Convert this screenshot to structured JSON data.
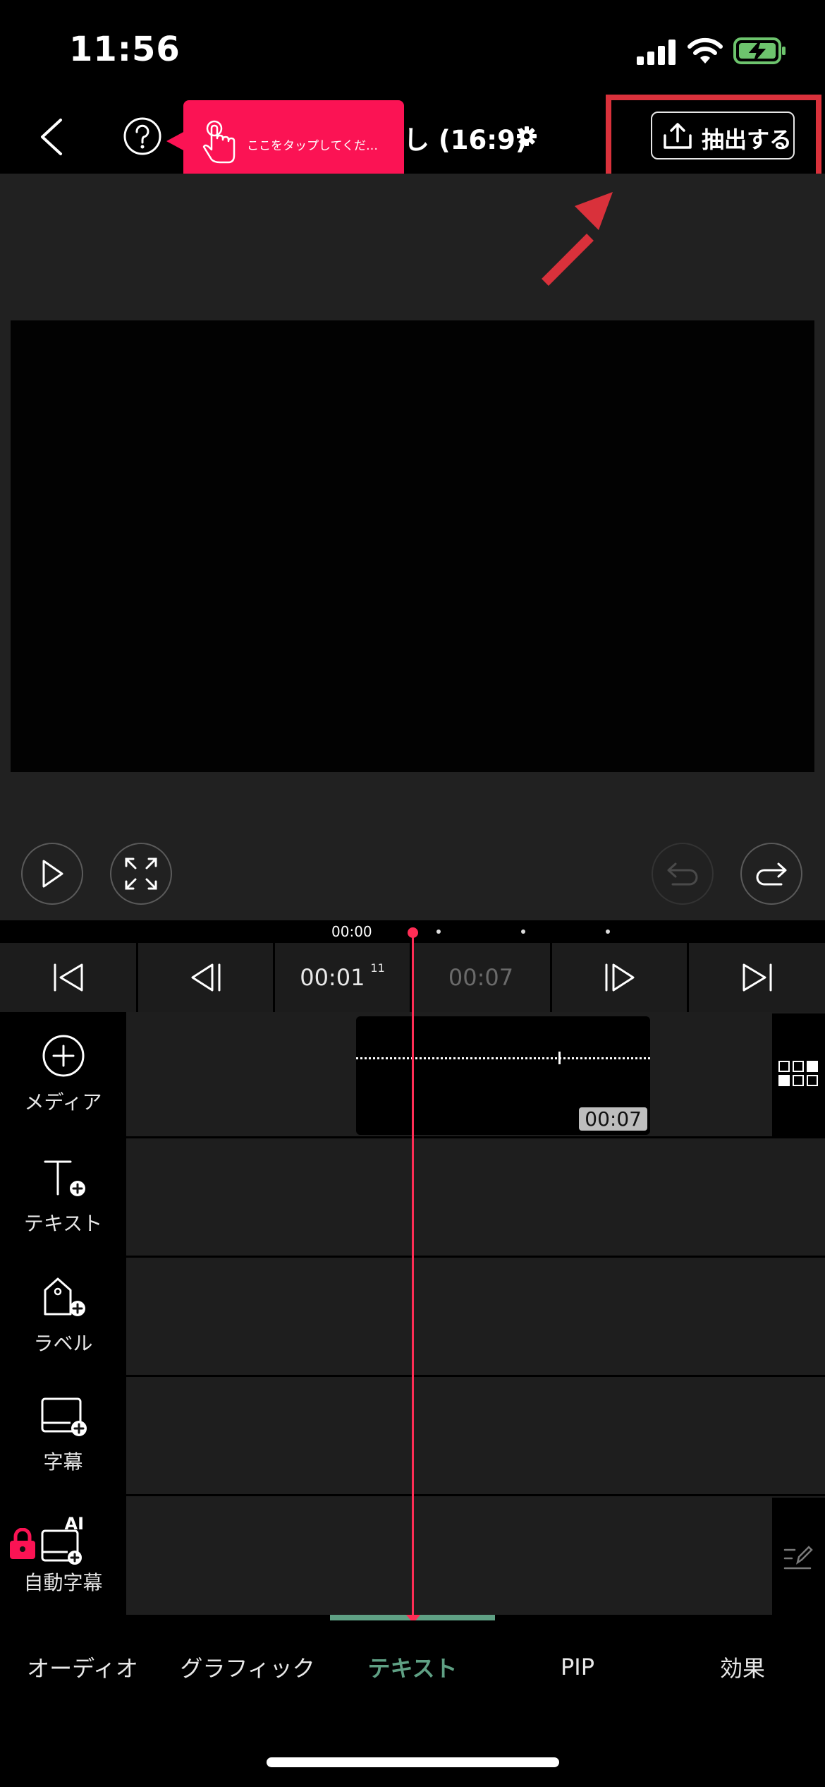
{
  "status_bar": {
    "time": "11:56"
  },
  "header": {
    "title": "し (16:9)",
    "tooltip_text": "ここをタップしてくだ…",
    "export_label": "抽出する"
  },
  "timeline": {
    "ruler_time": "00:00",
    "current_time": "00:01",
    "current_frame": "11",
    "duration": "00:07",
    "clip_duration": "00:07"
  },
  "tracks": {
    "media": "メディア",
    "text": "テキスト",
    "label": "ラベル",
    "subtitle": "字幕",
    "auto_subtitle": "自動字幕",
    "ai_badge": "AI"
  },
  "tabs": [
    {
      "label": "オーディオ"
    },
    {
      "label": "グラフィック"
    },
    {
      "label": "テキスト",
      "active": true
    },
    {
      "label": "PIP"
    },
    {
      "label": "効果"
    }
  ],
  "colors": {
    "accent": "#5fa084",
    "playhead": "#ff2d55",
    "tooltip": "#fb1354",
    "highlight": "#d9313b"
  },
  "icons": {
    "back": "chevron-left-icon",
    "help": "question-icon",
    "settings": "gear-icon",
    "export": "upload-icon",
    "play": "play-icon",
    "fullscreen": "expand-icon",
    "undo": "undo-icon",
    "redo": "redo-icon",
    "lock": "lock-icon"
  }
}
